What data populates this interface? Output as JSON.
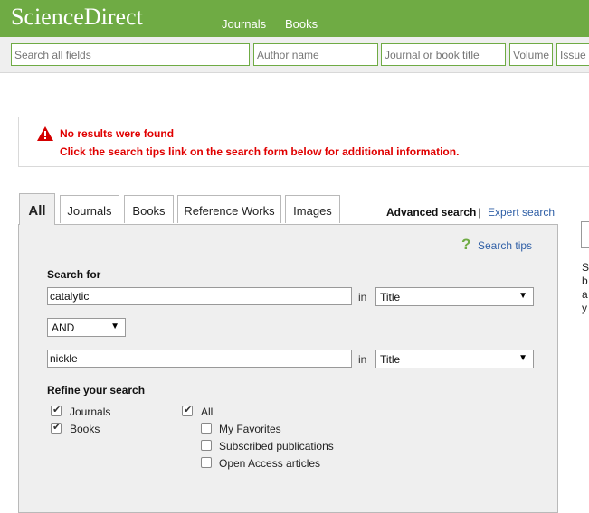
{
  "header": {
    "logo": "ScienceDirect",
    "nav": [
      "Journals",
      "Books"
    ]
  },
  "search_bar": {
    "all_fields_placeholder": "Search all fields",
    "author_placeholder": "Author name",
    "journal_placeholder": "Journal or book title",
    "volume_placeholder": "Volume",
    "issue_placeholder": "Issue"
  },
  "alert": {
    "title": "No results were found",
    "message": "Click the search tips link on the search form below for additional information."
  },
  "tabs": [
    "All",
    "Journals",
    "Books",
    "Reference Works",
    "Images"
  ],
  "links": {
    "advanced": "Advanced search",
    "separator": "|",
    "expert": "Expert search",
    "tips": "Search tips"
  },
  "form": {
    "search_for_label": "Search for",
    "term1": "catalytic",
    "in_label": "in",
    "field1": "Title",
    "operator": "AND",
    "term2": "nickle",
    "field2": "Title",
    "refine_label": "Refine your search",
    "content_types": [
      {
        "label": "Journals",
        "checked": true
      },
      {
        "label": "Books",
        "checked": true
      }
    ],
    "access": [
      {
        "label": "All",
        "checked": true
      },
      {
        "label": "My Favorites",
        "checked": false
      },
      {
        "label": "Subscribed publications",
        "checked": false
      },
      {
        "label": "Open Access articles",
        "checked": false
      }
    ]
  },
  "right_fragment": [
    "S",
    "b",
    "a",
    "y"
  ],
  "colors": {
    "brand_green": "#6fab44",
    "alert_red": "#e00000",
    "link_blue": "#2f5fa6"
  }
}
